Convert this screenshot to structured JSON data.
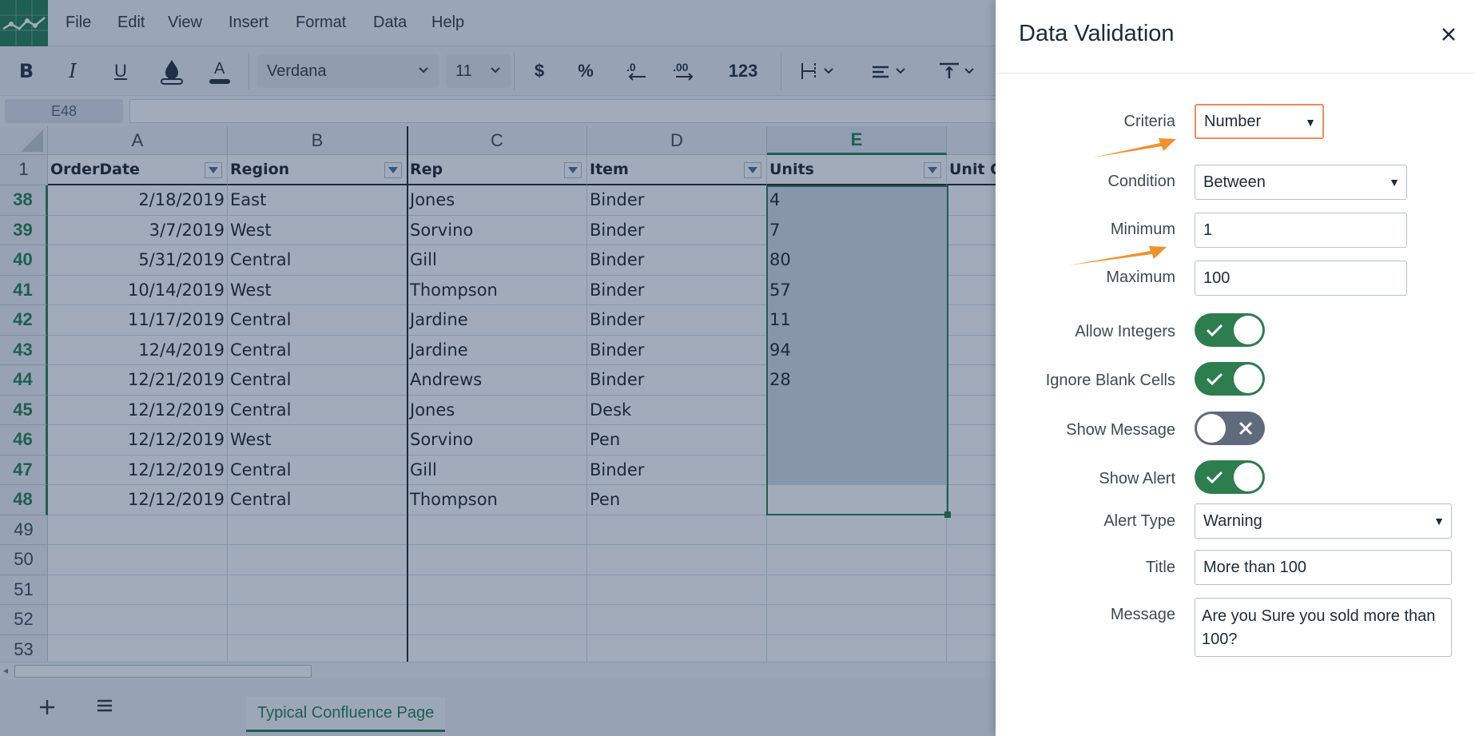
{
  "menu": [
    "File",
    "Edit",
    "View",
    "Insert",
    "Format",
    "Data",
    "Help"
  ],
  "toolbar": {
    "bold": "B",
    "italic": "I",
    "underline": "U",
    "font_name": "Verdana",
    "font_size": "11",
    "currency": "$",
    "percent": "%",
    "number_format": "123"
  },
  "formula_bar": {
    "cell_ref": "E48",
    "value": ""
  },
  "grid": {
    "columns": [
      "A",
      "B",
      "C",
      "D",
      "E"
    ],
    "header_row_number": "1",
    "headers": [
      "OrderDate",
      "Region",
      "Rep",
      "Item",
      "Units",
      "Unit Co"
    ],
    "rows": [
      {
        "n": "38",
        "a": "2/18/2019",
        "b": "East",
        "c": "Jones",
        "d": "Binder",
        "e": "4"
      },
      {
        "n": "39",
        "a": "3/7/2019",
        "b": "West",
        "c": "Sorvino",
        "d": "Binder",
        "e": "7"
      },
      {
        "n": "40",
        "a": "5/31/2019",
        "b": "Central",
        "c": "Gill",
        "d": "Binder",
        "e": "80"
      },
      {
        "n": "41",
        "a": "10/14/2019",
        "b": "West",
        "c": "Thompson",
        "d": "Binder",
        "e": "57"
      },
      {
        "n": "42",
        "a": "11/17/2019",
        "b": "Central",
        "c": "Jardine",
        "d": "Binder",
        "e": "11"
      },
      {
        "n": "43",
        "a": "12/4/2019",
        "b": "Central",
        "c": "Jardine",
        "d": "Binder",
        "e": "94"
      },
      {
        "n": "44",
        "a": "12/21/2019",
        "b": "Central",
        "c": "Andrews",
        "d": "Binder",
        "e": "28"
      },
      {
        "n": "45",
        "a": "12/12/2019",
        "b": "Central",
        "c": "Jones",
        "d": "Desk",
        "e": ""
      },
      {
        "n": "46",
        "a": "12/12/2019",
        "b": "West",
        "c": "Sorvino",
        "d": "Pen",
        "e": ""
      },
      {
        "n": "47",
        "a": "12/12/2019",
        "b": "Central",
        "c": "Gill",
        "d": "Binder",
        "e": ""
      },
      {
        "n": "48",
        "a": "12/12/2019",
        "b": "Central",
        "c": "Thompson",
        "d": "Pen",
        "e": ""
      },
      {
        "n": "49",
        "a": "",
        "b": "",
        "c": "",
        "d": "",
        "e": ""
      },
      {
        "n": "50",
        "a": "",
        "b": "",
        "c": "",
        "d": "",
        "e": ""
      },
      {
        "n": "51",
        "a": "",
        "b": "",
        "c": "",
        "d": "",
        "e": ""
      },
      {
        "n": "52",
        "a": "",
        "b": "",
        "c": "",
        "d": "",
        "e": ""
      },
      {
        "n": "53",
        "a": "",
        "b": "",
        "c": "",
        "d": "",
        "e": ""
      }
    ]
  },
  "sheet_tab": "Typical Confluence Page",
  "dialog": {
    "title": "Data Validation",
    "criteria_label": "Criteria",
    "criteria_value": "Number",
    "condition_label": "Condition",
    "condition_value": "Between",
    "minimum_label": "Minimum",
    "minimum_value": "1",
    "maximum_label": "Maximum",
    "maximum_value": "100",
    "allow_integers_label": "Allow Integers",
    "allow_integers": true,
    "ignore_blank_label": "Ignore Blank Cells",
    "ignore_blank": true,
    "show_message_label": "Show Message",
    "show_message": false,
    "show_alert_label": "Show Alert",
    "show_alert": true,
    "alert_type_label": "Alert Type",
    "alert_type_value": "Warning",
    "title_label": "Title",
    "title_value": "More than 100",
    "message_label": "Message",
    "message_value": "Are you Sure you sold more than 100?"
  },
  "colors": {
    "accent_green": "#1f7a4d",
    "overlay": "#1e375a",
    "annotation_arrow": "#f0902e",
    "criteria_highlight": "#ef8a5b"
  }
}
